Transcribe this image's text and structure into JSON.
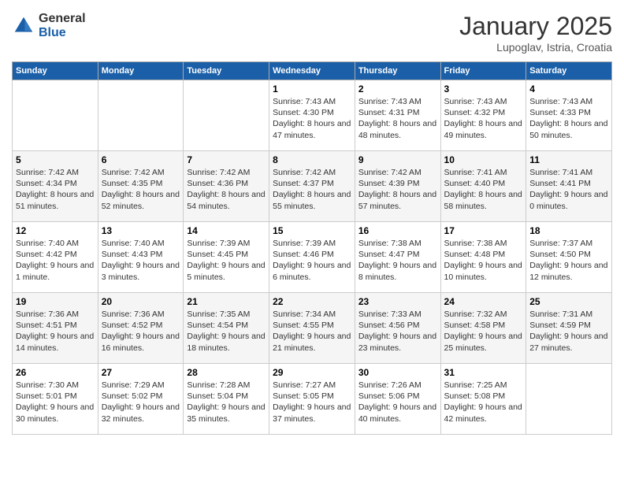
{
  "header": {
    "logo_general": "General",
    "logo_blue": "Blue",
    "month_title": "January 2025",
    "location": "Lupoglav, Istria, Croatia"
  },
  "weekdays": [
    "Sunday",
    "Monday",
    "Tuesday",
    "Wednesday",
    "Thursday",
    "Friday",
    "Saturday"
  ],
  "weeks": [
    [
      {
        "day": "",
        "content": ""
      },
      {
        "day": "",
        "content": ""
      },
      {
        "day": "",
        "content": ""
      },
      {
        "day": "1",
        "content": "Sunrise: 7:43 AM\nSunset: 4:30 PM\nDaylight: 8 hours and 47 minutes."
      },
      {
        "day": "2",
        "content": "Sunrise: 7:43 AM\nSunset: 4:31 PM\nDaylight: 8 hours and 48 minutes."
      },
      {
        "day": "3",
        "content": "Sunrise: 7:43 AM\nSunset: 4:32 PM\nDaylight: 8 hours and 49 minutes."
      },
      {
        "day": "4",
        "content": "Sunrise: 7:43 AM\nSunset: 4:33 PM\nDaylight: 8 hours and 50 minutes."
      }
    ],
    [
      {
        "day": "5",
        "content": "Sunrise: 7:42 AM\nSunset: 4:34 PM\nDaylight: 8 hours and 51 minutes."
      },
      {
        "day": "6",
        "content": "Sunrise: 7:42 AM\nSunset: 4:35 PM\nDaylight: 8 hours and 52 minutes."
      },
      {
        "day": "7",
        "content": "Sunrise: 7:42 AM\nSunset: 4:36 PM\nDaylight: 8 hours and 54 minutes."
      },
      {
        "day": "8",
        "content": "Sunrise: 7:42 AM\nSunset: 4:37 PM\nDaylight: 8 hours and 55 minutes."
      },
      {
        "day": "9",
        "content": "Sunrise: 7:42 AM\nSunset: 4:39 PM\nDaylight: 8 hours and 57 minutes."
      },
      {
        "day": "10",
        "content": "Sunrise: 7:41 AM\nSunset: 4:40 PM\nDaylight: 8 hours and 58 minutes."
      },
      {
        "day": "11",
        "content": "Sunrise: 7:41 AM\nSunset: 4:41 PM\nDaylight: 9 hours and 0 minutes."
      }
    ],
    [
      {
        "day": "12",
        "content": "Sunrise: 7:40 AM\nSunset: 4:42 PM\nDaylight: 9 hours and 1 minute."
      },
      {
        "day": "13",
        "content": "Sunrise: 7:40 AM\nSunset: 4:43 PM\nDaylight: 9 hours and 3 minutes."
      },
      {
        "day": "14",
        "content": "Sunrise: 7:39 AM\nSunset: 4:45 PM\nDaylight: 9 hours and 5 minutes."
      },
      {
        "day": "15",
        "content": "Sunrise: 7:39 AM\nSunset: 4:46 PM\nDaylight: 9 hours and 6 minutes."
      },
      {
        "day": "16",
        "content": "Sunrise: 7:38 AM\nSunset: 4:47 PM\nDaylight: 9 hours and 8 minutes."
      },
      {
        "day": "17",
        "content": "Sunrise: 7:38 AM\nSunset: 4:48 PM\nDaylight: 9 hours and 10 minutes."
      },
      {
        "day": "18",
        "content": "Sunrise: 7:37 AM\nSunset: 4:50 PM\nDaylight: 9 hours and 12 minutes."
      }
    ],
    [
      {
        "day": "19",
        "content": "Sunrise: 7:36 AM\nSunset: 4:51 PM\nDaylight: 9 hours and 14 minutes."
      },
      {
        "day": "20",
        "content": "Sunrise: 7:36 AM\nSunset: 4:52 PM\nDaylight: 9 hours and 16 minutes."
      },
      {
        "day": "21",
        "content": "Sunrise: 7:35 AM\nSunset: 4:54 PM\nDaylight: 9 hours and 18 minutes."
      },
      {
        "day": "22",
        "content": "Sunrise: 7:34 AM\nSunset: 4:55 PM\nDaylight: 9 hours and 21 minutes."
      },
      {
        "day": "23",
        "content": "Sunrise: 7:33 AM\nSunset: 4:56 PM\nDaylight: 9 hours and 23 minutes."
      },
      {
        "day": "24",
        "content": "Sunrise: 7:32 AM\nSunset: 4:58 PM\nDaylight: 9 hours and 25 minutes."
      },
      {
        "day": "25",
        "content": "Sunrise: 7:31 AM\nSunset: 4:59 PM\nDaylight: 9 hours and 27 minutes."
      }
    ],
    [
      {
        "day": "26",
        "content": "Sunrise: 7:30 AM\nSunset: 5:01 PM\nDaylight: 9 hours and 30 minutes."
      },
      {
        "day": "27",
        "content": "Sunrise: 7:29 AM\nSunset: 5:02 PM\nDaylight: 9 hours and 32 minutes."
      },
      {
        "day": "28",
        "content": "Sunrise: 7:28 AM\nSunset: 5:04 PM\nDaylight: 9 hours and 35 minutes."
      },
      {
        "day": "29",
        "content": "Sunrise: 7:27 AM\nSunset: 5:05 PM\nDaylight: 9 hours and 37 minutes."
      },
      {
        "day": "30",
        "content": "Sunrise: 7:26 AM\nSunset: 5:06 PM\nDaylight: 9 hours and 40 minutes."
      },
      {
        "day": "31",
        "content": "Sunrise: 7:25 AM\nSunset: 5:08 PM\nDaylight: 9 hours and 42 minutes."
      },
      {
        "day": "",
        "content": ""
      }
    ]
  ]
}
